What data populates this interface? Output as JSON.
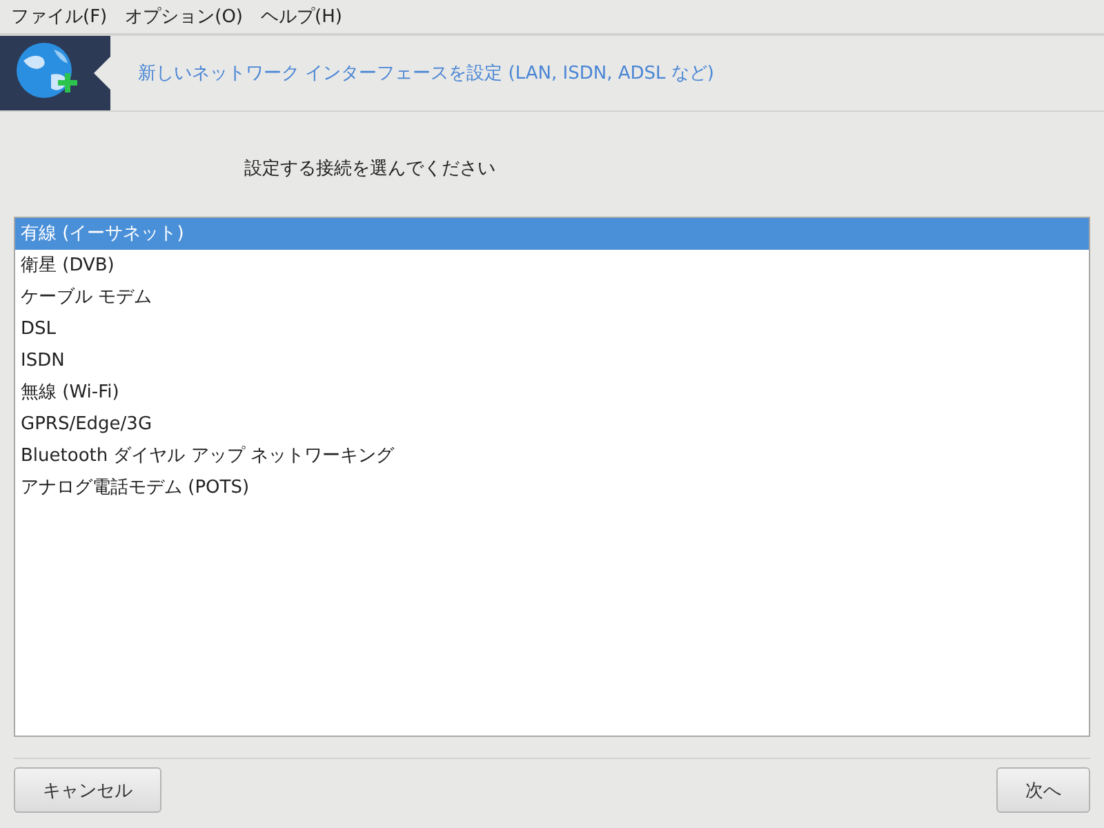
{
  "menu": [
    "ファイル(F)",
    "オプション(O)",
    "ヘルプ(H)"
  ],
  "header": {
    "title": "新しいネットワーク インターフェースを設定 (LAN, ISDN, ADSL など)"
  },
  "prompt": "設定する接続を選んでください",
  "connections": [
    {
      "label": "有線 (イーサネット)",
      "selected": true
    },
    {
      "label": "衛星 (DVB)",
      "selected": false
    },
    {
      "label": "ケーブル モデム",
      "selected": false
    },
    {
      "label": "DSL",
      "selected": false
    },
    {
      "label": "ISDN",
      "selected": false
    },
    {
      "label": "無線 (Wi-Fi)",
      "selected": false
    },
    {
      "label": "GPRS/Edge/3G",
      "selected": false
    },
    {
      "label": "Bluetooth ダイヤル アップ ネットワーキング",
      "selected": false
    },
    {
      "label": "アナログ電話モデム (POTS)",
      "selected": false
    }
  ],
  "buttons": {
    "cancel": "キャンセル",
    "next": "次へ"
  }
}
